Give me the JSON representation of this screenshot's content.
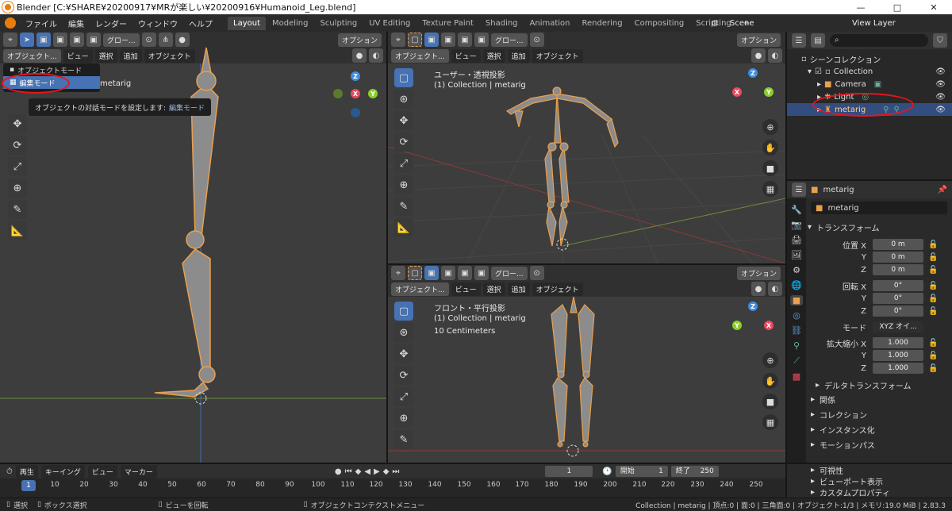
{
  "window": {
    "title": "Blender [C:¥SHARE¥20200917¥MRが楽しい¥20200916¥Humanoid_Leg.blend]",
    "minimize": "—",
    "maximize": "□",
    "close": "✕"
  },
  "menus": [
    "ファイル",
    "編集",
    "レンダー",
    "ウィンドウ",
    "ヘルプ"
  ],
  "workspaces": [
    "Layout",
    "Modeling",
    "Sculpting",
    "UV Editing",
    "Texture Paint",
    "Shading",
    "Animation",
    "Rendering",
    "Compositing",
    "Scripting"
  ],
  "add_tab": "+",
  "scene": {
    "label": "Scene",
    "view_layer": "View Layer"
  },
  "header": {
    "mode": "オブジェクト...",
    "view": "ビュー",
    "select": "選択",
    "add": "追加",
    "object": "オブジェクト",
    "global": "グロー...",
    "options": "オプション"
  },
  "left_viewport": {
    "object_label": "metarig"
  },
  "mode_menu": {
    "item1": "オブジェクトモード",
    "item2": "編集モード",
    "tooltip_prefix": "オブジェクトの対話モードを設定します:",
    "tooltip_value": "編集モード"
  },
  "persp_viewport": {
    "line1": "ユーザー・透視投影",
    "line2": "(1) Collection | metarig"
  },
  "front_viewport": {
    "line1": "フロント・平行投影",
    "line2": "(1) Collection | metarig",
    "line3": "10 Centimeters"
  },
  "gizmo": {
    "x": "X",
    "y": "Y",
    "z": "Z"
  },
  "outliner": {
    "scene_collection": "シーンコレクション",
    "collection": "Collection",
    "camera": "Camera",
    "light": "Light",
    "metarig": "metarig"
  },
  "properties": {
    "object_name": "metarig",
    "object_field": "metarig",
    "transform": "トランスフォーム",
    "location_label": "位置 X",
    "loc": [
      "0 m",
      "0 m",
      "0 m"
    ],
    "rotation_label": "回転 X",
    "rot": [
      "0°",
      "0°",
      "0°"
    ],
    "mode_label": "モード",
    "mode_value": "XYZ オイ...",
    "scale_label": "拡大縮小 X",
    "scale": [
      "1.000",
      "1.000",
      "1.000"
    ],
    "axes": [
      "Y",
      "Z"
    ],
    "delta": "デルタトランスフォーム",
    "sections": [
      "関係",
      "コレクション",
      "インスタンス化",
      "モーションパス",
      "可視性",
      "ビューポート表示",
      "カスタムプロパティ"
    ]
  },
  "timeline": {
    "playback": "再生",
    "keying": "キーイング",
    "view": "ビュー",
    "marker": "マーカー",
    "current": "1",
    "start_label": "開始",
    "start": "1",
    "end_label": "終了",
    "end": "250",
    "current_marker": "1",
    "ticks": [
      "10",
      "20",
      "30",
      "40",
      "50",
      "60",
      "70",
      "80",
      "90",
      "100",
      "110",
      "120",
      "130",
      "140",
      "150",
      "160",
      "170",
      "180",
      "190",
      "200",
      "210",
      "220",
      "230",
      "240",
      "250"
    ]
  },
  "status": {
    "select": "選択",
    "box": "ボックス選択",
    "rotate": "ビューを回転",
    "context": "オブジェクトコンテクストメニュー",
    "info": "Collection | metarig | 頂点:0 | 面:0 | 三角面:0 | オブジェクト:1/3 | メモリ:19.0 MiB | 2.83.3"
  },
  "colors": {
    "accent": "#4772b3",
    "bone": "#e8a050",
    "red_circle": "#e8151b",
    "x_axis": "#e84a5f",
    "y_axis": "#8ccf2d",
    "z_axis": "#3f8de0"
  }
}
